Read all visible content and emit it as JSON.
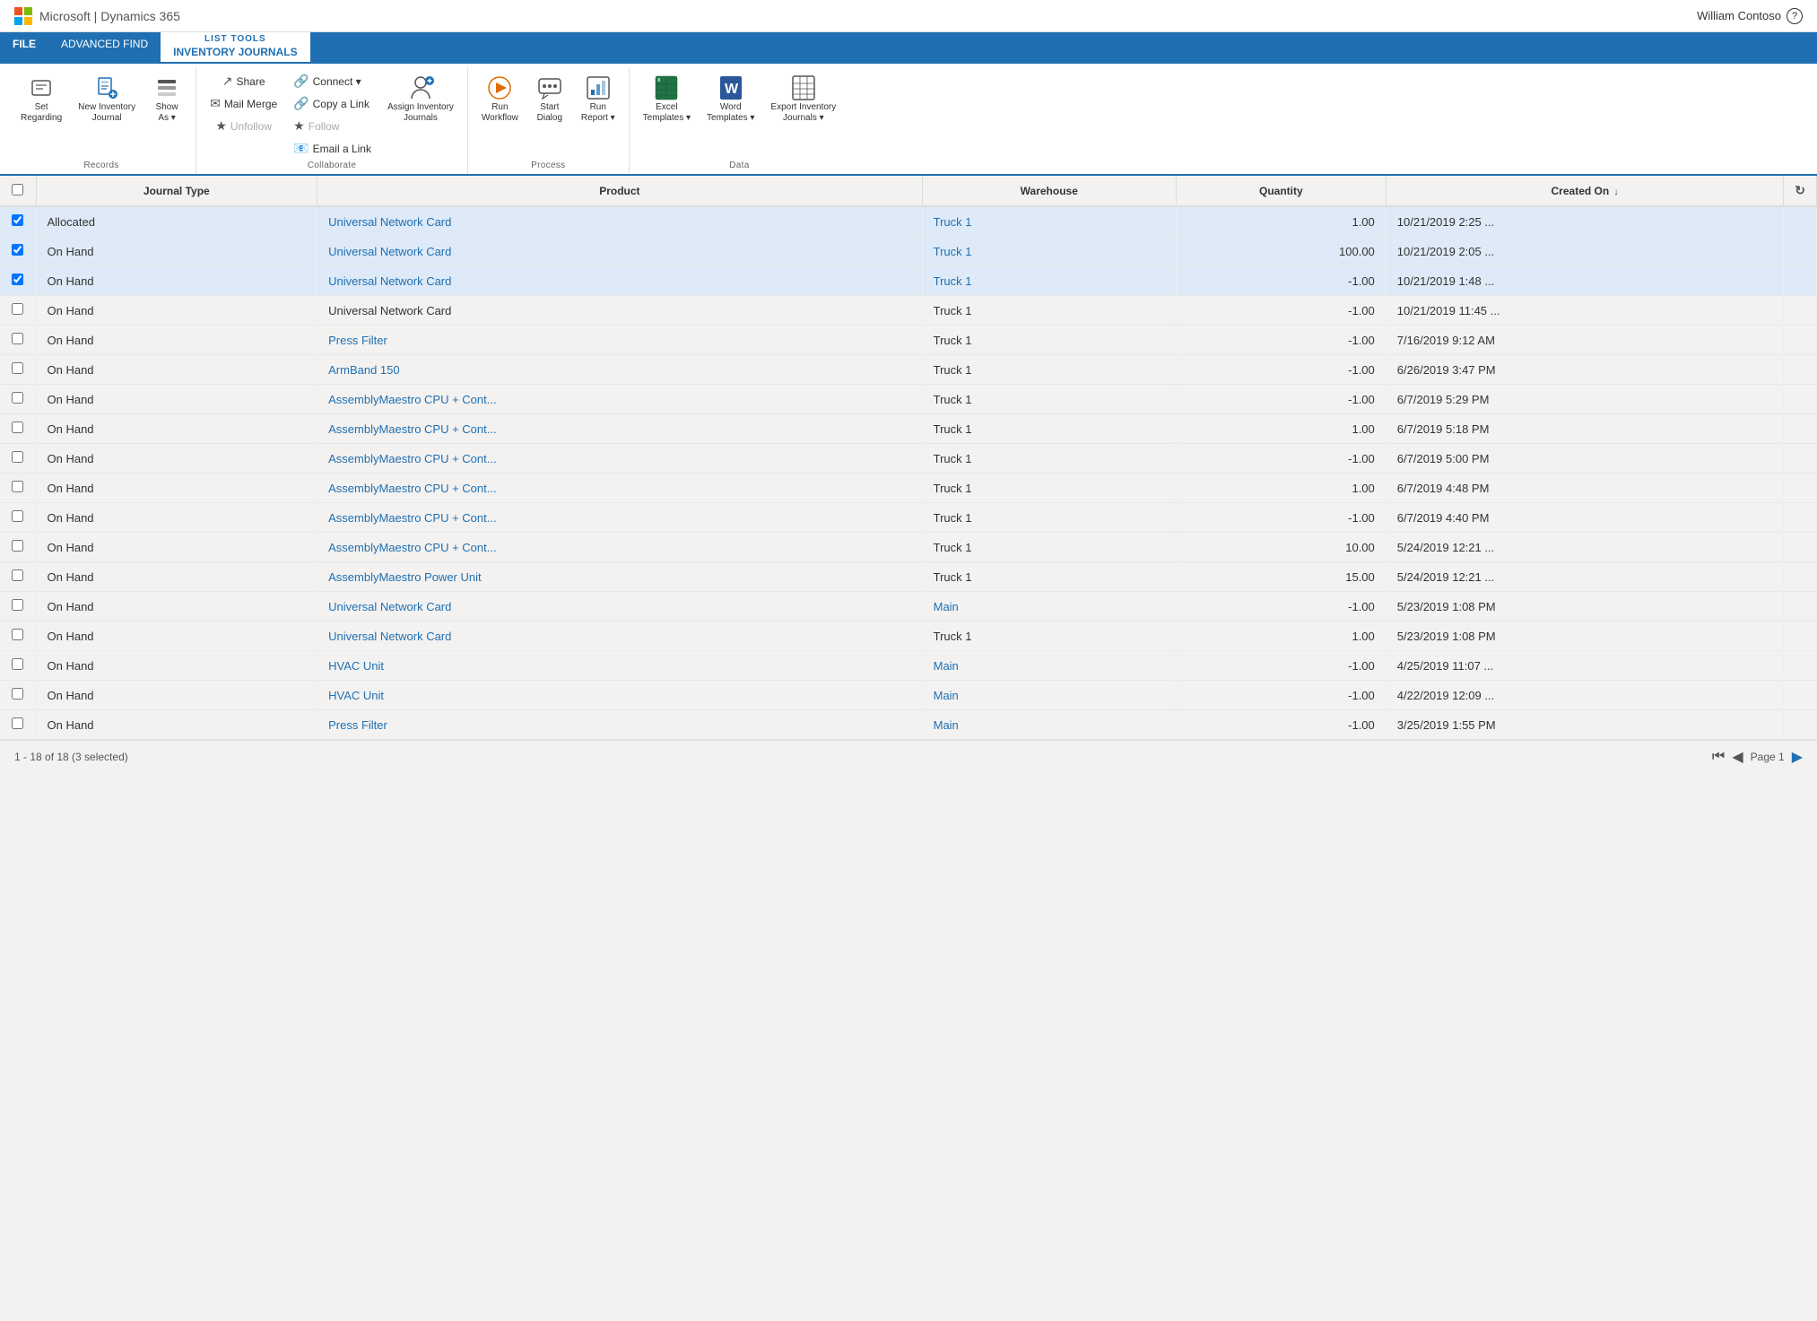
{
  "topbar": {
    "brand": "Microsoft  |  Dynamics 365",
    "user": "William Contoso",
    "help": "?"
  },
  "ribbon": {
    "tabs": [
      {
        "id": "file",
        "label": "FILE",
        "active": false
      },
      {
        "id": "advanced-find",
        "label": "ADVANCED FIND",
        "active": false
      },
      {
        "id": "list-tools",
        "label": "LIST TOOLS",
        "active": true,
        "subtitle": "INVENTORY JOURNALS"
      }
    ],
    "groups": {
      "records": {
        "label": "Records",
        "buttons": [
          {
            "id": "set-regarding",
            "label": "Set\nRegarding",
            "icon": "📋"
          },
          {
            "id": "new-inventory-journal",
            "label": "New Inventory\nJournal",
            "icon": "📄"
          },
          {
            "id": "show-as",
            "label": "Show\nAs ▾",
            "icon": "📊"
          }
        ]
      },
      "collaborate": {
        "label": "Collaborate",
        "top": [
          {
            "id": "mail-merge",
            "label": "Mail Merge",
            "icon": "✉"
          },
          {
            "id": "unfollow",
            "label": "Unfollow",
            "icon": "★",
            "disabled": true
          },
          {
            "id": "connect",
            "label": "Connect ▾",
            "icon": "🔗"
          },
          {
            "id": "copy-a-link",
            "label": "Copy a Link",
            "icon": "🔗"
          }
        ],
        "bottom": [
          {
            "id": "follow",
            "label": "Follow",
            "icon": "★",
            "disabled": true
          },
          {
            "id": "email-a-link",
            "label": "Email a Link",
            "icon": "📧"
          }
        ],
        "assign": {
          "id": "assign-inventory-journals",
          "label": "Assign Inventory\nJournals",
          "icon": "👤"
        },
        "share": {
          "id": "share",
          "label": "Share",
          "icon": "↗"
        }
      },
      "process": {
        "label": "Process",
        "buttons": [
          {
            "id": "run-workflow",
            "label": "Run\nWorkflow",
            "icon": "⚙"
          },
          {
            "id": "start-dialog",
            "label": "Start\nDialog",
            "icon": "💬"
          },
          {
            "id": "run-report",
            "label": "Run\nReport ▾",
            "icon": "📈"
          }
        ]
      },
      "data": {
        "label": "Data",
        "buttons": [
          {
            "id": "excel-templates",
            "label": "Excel\nTemplates ▾",
            "icon": "📗"
          },
          {
            "id": "word-templates",
            "label": "Word\nTemplates ▾",
            "icon": "📘"
          },
          {
            "id": "export-inventory-journals",
            "label": "Export Inventory\nJournals ▾",
            "icon": "📊"
          }
        ]
      }
    }
  },
  "table": {
    "columns": [
      {
        "id": "checkbox",
        "label": ""
      },
      {
        "id": "journal-type",
        "label": "Journal Type"
      },
      {
        "id": "product",
        "label": "Product"
      },
      {
        "id": "warehouse",
        "label": "Warehouse"
      },
      {
        "id": "quantity",
        "label": "Quantity"
      },
      {
        "id": "created-on",
        "label": "Created On",
        "sorted": "desc"
      }
    ],
    "rows": [
      {
        "id": 1,
        "checked": true,
        "journalType": "Allocated",
        "product": "Universal Network Card",
        "productLink": true,
        "warehouse": "Truck 1",
        "warehouseLink": true,
        "quantity": "1.00",
        "createdOn": "10/21/2019 2:25 ..."
      },
      {
        "id": 2,
        "checked": true,
        "journalType": "On Hand",
        "product": "Universal Network Card",
        "productLink": true,
        "warehouse": "Truck 1",
        "warehouseLink": true,
        "quantity": "100.00",
        "createdOn": "10/21/2019 2:05 ..."
      },
      {
        "id": 3,
        "checked": true,
        "journalType": "On Hand",
        "product": "Universal Network Card",
        "productLink": true,
        "warehouse": "Truck 1",
        "warehouseLink": true,
        "quantity": "-1.00",
        "createdOn": "10/21/2019 1:48 ..."
      },
      {
        "id": 4,
        "checked": false,
        "journalType": "On Hand",
        "product": "Universal Network Card",
        "productLink": false,
        "warehouse": "Truck 1",
        "warehouseLink": false,
        "quantity": "-1.00",
        "createdOn": "10/21/2019 11:45 ..."
      },
      {
        "id": 5,
        "checked": false,
        "journalType": "On Hand",
        "product": "Press Filter",
        "productLink": true,
        "warehouse": "Truck 1",
        "warehouseLink": false,
        "quantity": "-1.00",
        "createdOn": "7/16/2019 9:12 AM"
      },
      {
        "id": 6,
        "checked": false,
        "journalType": "On Hand",
        "product": "ArmBand 150",
        "productLink": true,
        "warehouse": "Truck 1",
        "warehouseLink": false,
        "quantity": "-1.00",
        "createdOn": "6/26/2019 3:47 PM"
      },
      {
        "id": 7,
        "checked": false,
        "journalType": "On Hand",
        "product": "AssemblyMaestro CPU + Cont...",
        "productLink": true,
        "warehouse": "Truck 1",
        "warehouseLink": false,
        "quantity": "-1.00",
        "createdOn": "6/7/2019 5:29 PM"
      },
      {
        "id": 8,
        "checked": false,
        "journalType": "On Hand",
        "product": "AssemblyMaestro CPU + Cont...",
        "productLink": true,
        "warehouse": "Truck 1",
        "warehouseLink": false,
        "quantity": "1.00",
        "createdOn": "6/7/2019 5:18 PM"
      },
      {
        "id": 9,
        "checked": false,
        "journalType": "On Hand",
        "product": "AssemblyMaestro CPU + Cont...",
        "productLink": true,
        "warehouse": "Truck 1",
        "warehouseLink": false,
        "quantity": "-1.00",
        "createdOn": "6/7/2019 5:00 PM"
      },
      {
        "id": 10,
        "checked": false,
        "journalType": "On Hand",
        "product": "AssemblyMaestro CPU + Cont...",
        "productLink": true,
        "warehouse": "Truck 1",
        "warehouseLink": false,
        "quantity": "1.00",
        "createdOn": "6/7/2019 4:48 PM"
      },
      {
        "id": 11,
        "checked": false,
        "journalType": "On Hand",
        "product": "AssemblyMaestro CPU + Cont...",
        "productLink": true,
        "warehouse": "Truck 1",
        "warehouseLink": false,
        "quantity": "-1.00",
        "createdOn": "6/7/2019 4:40 PM"
      },
      {
        "id": 12,
        "checked": false,
        "journalType": "On Hand",
        "product": "AssemblyMaestro CPU + Cont...",
        "productLink": true,
        "warehouse": "Truck 1",
        "warehouseLink": false,
        "quantity": "10.00",
        "createdOn": "5/24/2019 12:21 ..."
      },
      {
        "id": 13,
        "checked": false,
        "journalType": "On Hand",
        "product": "AssemblyMaestro Power Unit",
        "productLink": true,
        "warehouse": "Truck 1",
        "warehouseLink": false,
        "quantity": "15.00",
        "createdOn": "5/24/2019 12:21 ..."
      },
      {
        "id": 14,
        "checked": false,
        "journalType": "On Hand",
        "product": "Universal Network Card",
        "productLink": true,
        "warehouse": "Main",
        "warehouseLink": true,
        "quantity": "-1.00",
        "createdOn": "5/23/2019 1:08 PM"
      },
      {
        "id": 15,
        "checked": false,
        "journalType": "On Hand",
        "product": "Universal Network Card",
        "productLink": true,
        "warehouse": "Truck 1",
        "warehouseLink": false,
        "quantity": "1.00",
        "createdOn": "5/23/2019 1:08 PM"
      },
      {
        "id": 16,
        "checked": false,
        "journalType": "On Hand",
        "product": "HVAC Unit",
        "productLink": true,
        "warehouse": "Main",
        "warehouseLink": true,
        "quantity": "-1.00",
        "createdOn": "4/25/2019 11:07 ..."
      },
      {
        "id": 17,
        "checked": false,
        "journalType": "On Hand",
        "product": "HVAC Unit",
        "productLink": true,
        "warehouse": "Main",
        "warehouseLink": true,
        "quantity": "-1.00",
        "createdOn": "4/22/2019 12:09 ..."
      },
      {
        "id": 18,
        "checked": false,
        "journalType": "On Hand",
        "product": "Press Filter",
        "productLink": true,
        "warehouse": "Main",
        "warehouseLink": true,
        "quantity": "-1.00",
        "createdOn": "3/25/2019 1:55 PM"
      }
    ]
  },
  "statusbar": {
    "info": "1 - 18 of 18 (3 selected)",
    "page": "Page 1"
  }
}
